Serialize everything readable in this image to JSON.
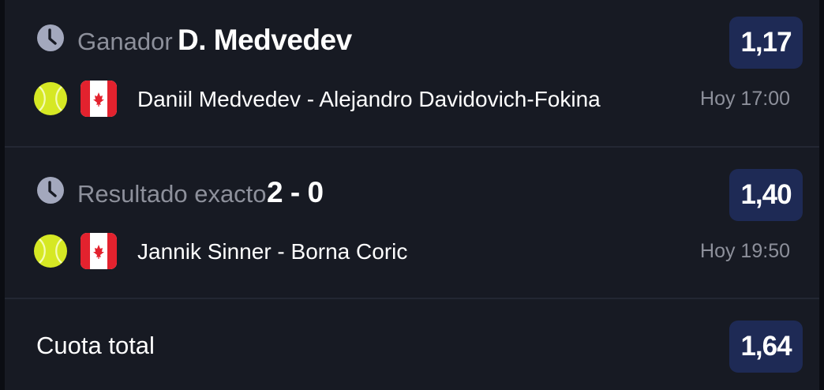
{
  "bets": [
    {
      "market": "Ganador",
      "selection": "D. Medvedev",
      "odds": "1,17",
      "match": "Daniil Medvedev - Alejandro Davidovich-Fokina",
      "time": "Hoy 17:00",
      "sport_icon": "tennis-ball-icon",
      "flag_icon": "canada-flag-icon"
    },
    {
      "market": "Resultado exacto",
      "selection": "2 - 0",
      "odds": "1,40",
      "match": "Jannik Sinner - Borna Coric",
      "time": "Hoy 19:50",
      "sport_icon": "tennis-ball-icon",
      "flag_icon": "canada-flag-icon"
    }
  ],
  "total": {
    "label": "Cuota total",
    "odds": "1,64"
  },
  "colors": {
    "background": "#0b0d13",
    "panel": "#171a23",
    "odds_badge": "#1e2a55",
    "muted_text": "#8d909b",
    "tennis_ball": "#d6e824",
    "flag_red": "#e3222e"
  }
}
